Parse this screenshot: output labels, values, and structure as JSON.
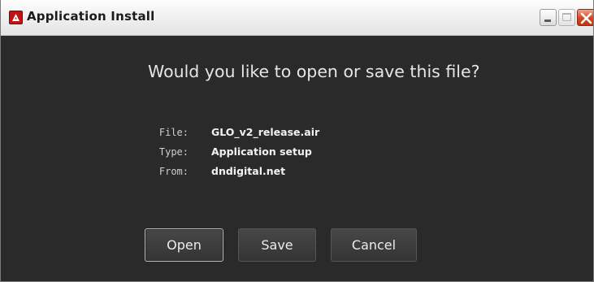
{
  "window": {
    "title": "Application Install",
    "controls": {
      "minimize": "minimize",
      "maximize": "maximize",
      "close": "close"
    }
  },
  "dialog": {
    "question": "Would you like to open or save this file?",
    "details": [
      {
        "label": "File:",
        "value": "GLO_v2_release.air"
      },
      {
        "label": "Type:",
        "value": "Application setup"
      },
      {
        "label": "From:",
        "value": "dndigital.net"
      }
    ]
  },
  "buttons": {
    "open": "Open",
    "save": "Save",
    "cancel": "Cancel"
  },
  "colors": {
    "background": "#2a2a2a",
    "titlebar": "#f1f1f1",
    "close_button": "#d9421d",
    "app_icon": "#c01414"
  },
  "icons": [
    "adobe-air-app-icon",
    "minimize-icon",
    "maximize-icon",
    "close-icon"
  ]
}
